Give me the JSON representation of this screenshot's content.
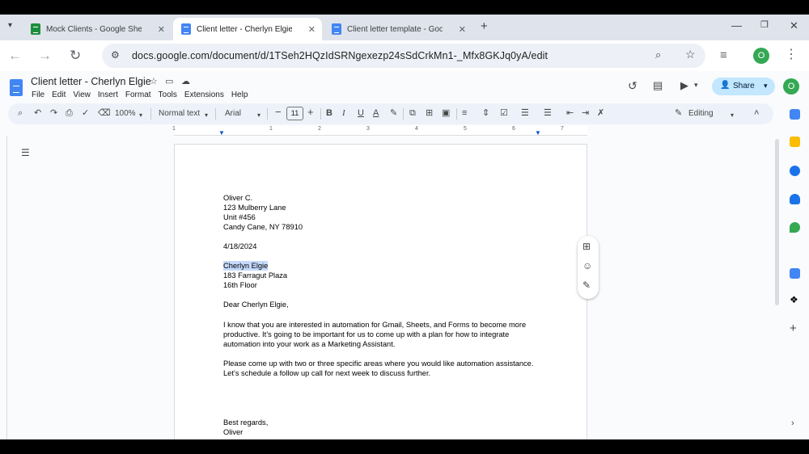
{
  "browser": {
    "tabs": [
      {
        "title": "Mock Clients - Google Sheets",
        "type": "sheets"
      },
      {
        "title": "Client letter - Cherlyn Elgie",
        "type": "docs"
      },
      {
        "title": "Client letter template - Google Docs",
        "type": "docs"
      }
    ],
    "close_glyph": "✕",
    "new_tab_glyph": "+",
    "url": "docs.google.com/document/d/1TSeh2HQzIdSRNgexezp24sSdCrkMn1-_Mfx8GKJq0yA/edit",
    "profile_initial": "O"
  },
  "docs": {
    "title": "Client letter - Cherlyn Elgie",
    "menu": [
      "File",
      "Edit",
      "View",
      "Insert",
      "Format",
      "Tools",
      "Extensions",
      "Help"
    ],
    "share_label": "Share",
    "profile_initial": "O"
  },
  "toolbar": {
    "zoom": "100%",
    "style": "Normal text",
    "font": "Arial",
    "font_size": "11",
    "bold": "B",
    "italic": "I",
    "underline": "U",
    "text_color": "A",
    "mode": "Editing"
  },
  "ruler": {
    "numbers": [
      "1",
      "1",
      "2",
      "3",
      "4",
      "5",
      "6",
      "7"
    ]
  },
  "letter": {
    "sender_name": "Oliver C.",
    "sender_street": "123 Mulberry Lane",
    "sender_unit": "Unit #456",
    "sender_city": "Candy Cane, NY 78910",
    "date": "4/18/2024",
    "recipient_name": "Cherlyn Elgie",
    "recipient_street": "183 Farragut Plaza",
    "recipient_floor": "16th Floor",
    "salutation": "Dear Cherlyn Elgie,",
    "p1_l1": "I know that you are interested in automation for Gmail, Sheets, and Forms to become more",
    "p1_l2": "productive. It’s going to be important for us to come up with a plan for how to integrate",
    "p1_l3": "automation into your work as a Marketing Assistant.",
    "p2_l1": "Please come up with two or three specific areas where you would like automation assistance.",
    "p2_l2": "Let’s schedule a follow up call for next week to discuss further.",
    "closing": "Best regards,",
    "signature": "Oliver"
  },
  "colors": {
    "accent": "#0b57d0",
    "share_bg": "#c2e7ff",
    "selection": "#c6dafc",
    "sheets_green": "#1e8e3e",
    "docs_blue": "#4285f4"
  }
}
